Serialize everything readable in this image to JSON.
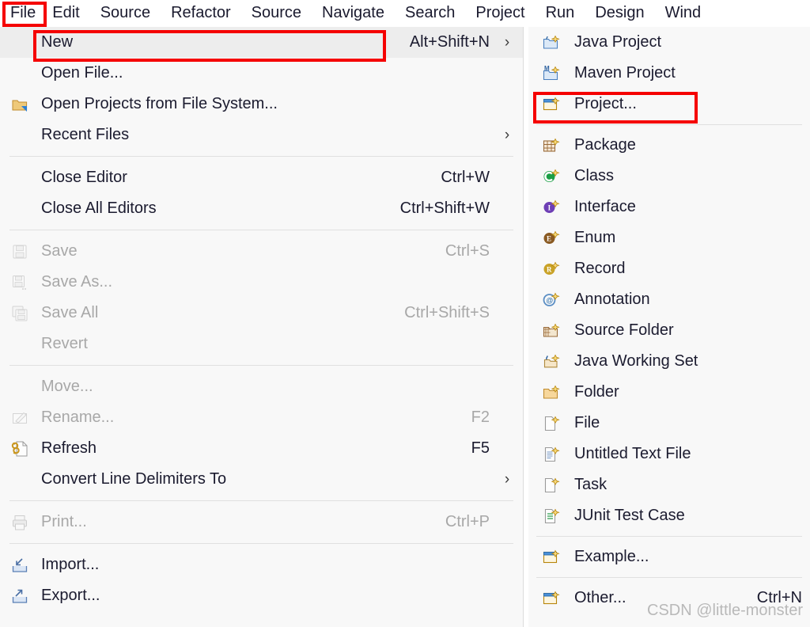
{
  "menubar": {
    "items": [
      {
        "label": "File",
        "active": true
      },
      {
        "label": "Edit"
      },
      {
        "label": "Source"
      },
      {
        "label": "Refactor"
      },
      {
        "label": "Source"
      },
      {
        "label": "Navigate"
      },
      {
        "label": "Search"
      },
      {
        "label": "Project"
      },
      {
        "label": "Run"
      },
      {
        "label": "Design"
      },
      {
        "label": "Wind"
      }
    ]
  },
  "file_menu": {
    "groups": [
      {
        "items": [
          {
            "label": "New",
            "accel": "Alt+Shift+N",
            "submenu": true,
            "hovered": true,
            "icon": "none",
            "disabled": false
          },
          {
            "label": "Open File...",
            "accel": "",
            "submenu": false,
            "icon": "none",
            "disabled": false
          },
          {
            "label": "Open Projects from File System...",
            "accel": "",
            "submenu": false,
            "icon": "folder-open-icon",
            "disabled": false
          },
          {
            "label": "Recent Files",
            "accel": "",
            "submenu": true,
            "icon": "none",
            "disabled": false
          }
        ]
      },
      {
        "items": [
          {
            "label": "Close Editor",
            "accel": "Ctrl+W",
            "submenu": false,
            "icon": "none",
            "disabled": false
          },
          {
            "label": "Close All Editors",
            "accel": "Ctrl+Shift+W",
            "submenu": false,
            "icon": "none",
            "disabled": false
          }
        ]
      },
      {
        "items": [
          {
            "label": "Save",
            "accel": "Ctrl+S",
            "submenu": false,
            "icon": "save-icon",
            "disabled": true
          },
          {
            "label": "Save As...",
            "accel": "",
            "submenu": false,
            "icon": "save-as-icon",
            "disabled": true
          },
          {
            "label": "Save All",
            "accel": "Ctrl+Shift+S",
            "submenu": false,
            "icon": "save-all-icon",
            "disabled": true
          },
          {
            "label": "Revert",
            "accel": "",
            "submenu": false,
            "icon": "none",
            "disabled": true
          }
        ]
      },
      {
        "items": [
          {
            "label": "Move...",
            "accel": "",
            "submenu": false,
            "icon": "none",
            "disabled": true
          },
          {
            "label": "Rename...",
            "accel": "F2",
            "submenu": false,
            "icon": "rename-icon",
            "disabled": true
          },
          {
            "label": "Refresh",
            "accel": "F5",
            "submenu": false,
            "icon": "refresh-icon",
            "disabled": false
          },
          {
            "label": "Convert Line Delimiters To",
            "accel": "",
            "submenu": true,
            "icon": "none",
            "disabled": false
          }
        ]
      },
      {
        "items": [
          {
            "label": "Print...",
            "accel": "Ctrl+P",
            "submenu": false,
            "icon": "print-icon",
            "disabled": true
          }
        ]
      },
      {
        "items": [
          {
            "label": "Import...",
            "accel": "",
            "submenu": false,
            "icon": "import-icon",
            "disabled": false
          },
          {
            "label": "Export...",
            "accel": "",
            "submenu": false,
            "icon": "export-icon",
            "disabled": false
          }
        ]
      }
    ]
  },
  "new_submenu": {
    "groups": [
      {
        "items": [
          {
            "label": "Java Project",
            "accel": "",
            "icon": "java-project-icon"
          },
          {
            "label": "Maven Project",
            "accel": "",
            "icon": "maven-project-icon"
          },
          {
            "label": "Project...",
            "accel": "",
            "icon": "project-icon",
            "highlighted": true
          }
        ]
      },
      {
        "items": [
          {
            "label": "Package",
            "accel": "",
            "icon": "package-icon"
          },
          {
            "label": "Class",
            "accel": "",
            "icon": "class-icon"
          },
          {
            "label": "Interface",
            "accel": "",
            "icon": "interface-icon"
          },
          {
            "label": "Enum",
            "accel": "",
            "icon": "enum-icon"
          },
          {
            "label": "Record",
            "accel": "",
            "icon": "record-icon"
          },
          {
            "label": "Annotation",
            "accel": "",
            "icon": "annotation-icon"
          },
          {
            "label": "Source Folder",
            "accel": "",
            "icon": "source-folder-icon"
          },
          {
            "label": "Java Working Set",
            "accel": "",
            "icon": "java-working-set-icon"
          },
          {
            "label": "Folder",
            "accel": "",
            "icon": "folder-icon"
          },
          {
            "label": "File",
            "accel": "",
            "icon": "file-icon"
          },
          {
            "label": "Untitled Text File",
            "accel": "",
            "icon": "untitled-text-file-icon"
          },
          {
            "label": "Task",
            "accel": "",
            "icon": "task-icon"
          },
          {
            "label": "JUnit Test Case",
            "accel": "",
            "icon": "junit-test-case-icon"
          }
        ]
      },
      {
        "items": [
          {
            "label": "Example...",
            "accel": "",
            "icon": "example-icon"
          }
        ]
      },
      {
        "items": [
          {
            "label": "Other...",
            "accel": "Ctrl+N",
            "icon": "other-icon"
          }
        ]
      }
    ]
  },
  "annotations": {
    "highlight_color": "#f50000",
    "boxes": [
      "file-menubar-item",
      "new-menu-item",
      "project-submenu-item"
    ]
  },
  "watermark": {
    "text": "CSDN @little-monster"
  }
}
